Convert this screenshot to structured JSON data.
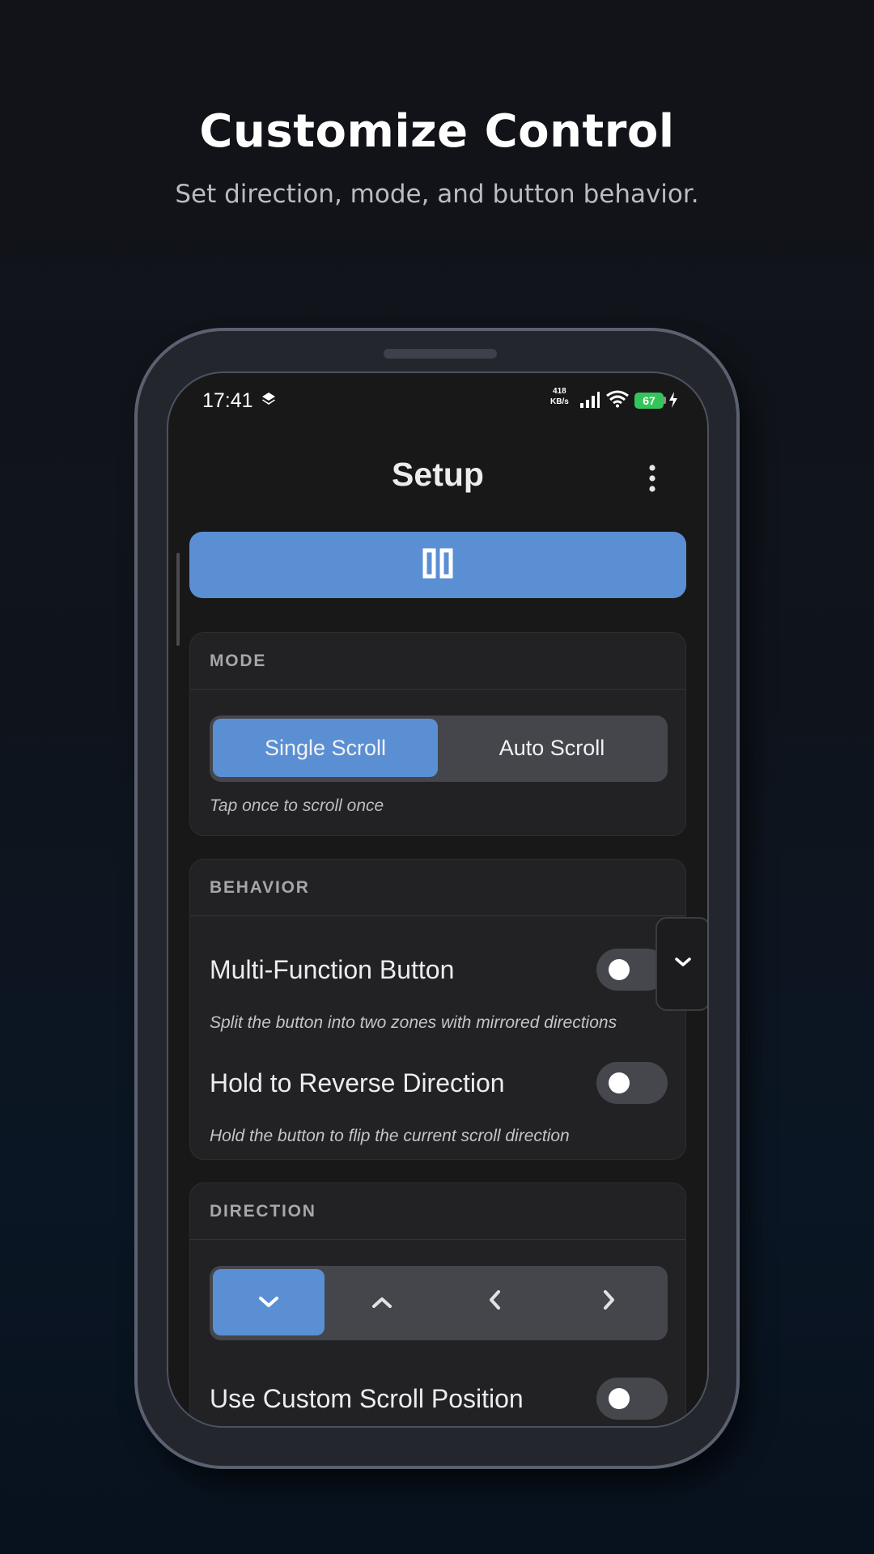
{
  "promo": {
    "title": "Customize Control",
    "subtitle": "Set direction, mode, and button behavior."
  },
  "status_bar": {
    "time": "17:41",
    "net_speed_value": "418",
    "net_speed_unit": "KB/s",
    "battery": "67"
  },
  "app_bar": {
    "title": "Setup"
  },
  "start_button": {
    "icon": "pause-icon"
  },
  "mode": {
    "header": "MODE",
    "options": [
      "Single Scroll",
      "Auto Scroll"
    ],
    "selected": "Single Scroll",
    "hint": "Tap once to scroll once"
  },
  "behavior": {
    "header": "BEHAVIOR",
    "multi_function": {
      "title": "Multi-Function Button",
      "description": "Split the button into two zones with mirrored directions",
      "enabled": false
    },
    "hold_reverse": {
      "title": "Hold to Reverse Direction",
      "description": "Hold the button to flip the current scroll direction",
      "enabled": false
    }
  },
  "direction": {
    "header": "DIRECTION",
    "options": [
      "chevron-down-icon",
      "chevron-up-icon",
      "chevron-left-icon",
      "chevron-right-icon"
    ],
    "selected": "chevron-down-icon",
    "custom_position": {
      "title": "Use Custom Scroll Position",
      "enabled": false
    }
  },
  "colors": {
    "accent": "#5b8fd4",
    "card": "#222224",
    "toggle_off": "#45474d",
    "battery": "#33c45a"
  }
}
